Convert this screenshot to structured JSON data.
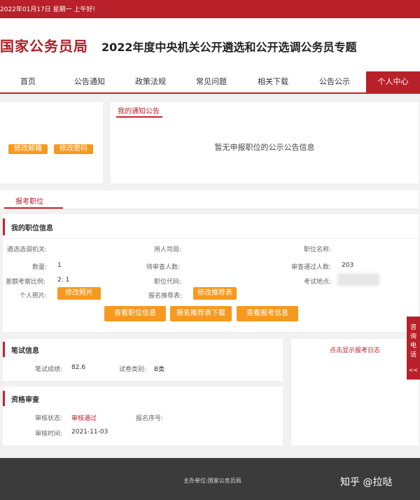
{
  "topbar": {
    "date": "2022年01月17日 星期一 上午好!"
  },
  "header": {
    "logo": "国家公务员局",
    "title": "2022年度中央机关公开遴选和公开选调公务员专题"
  },
  "nav": [
    "首页",
    "公告通知",
    "政策法规",
    "常见问题",
    "相关下载",
    "公告公示",
    "个人中心"
  ],
  "account": {
    "edit_email": "修改邮箱",
    "edit_password": "修改密码"
  },
  "notices": {
    "title": "我的通知公告",
    "empty": "暂无申报职位的公示公告信息"
  },
  "position_tab": "报考职位",
  "position": {
    "title": "我的职位信息",
    "agency_label": "遴选选调机关:",
    "department_label": "用人司局:",
    "name_label": "职位名称:",
    "count_label": "数量:",
    "count_value": "1",
    "pending_label": "待审查人数:",
    "passed_label": "审查通过人数:",
    "passed_value": "203",
    "ratio_label": "差额考察比例:",
    "ratio_value": "2: 1",
    "code_label": "职位代码:",
    "location_label": "考试地点:",
    "photo_label": "个人照片:",
    "photo_button": "修改照片",
    "form_label": "报名推荐表:",
    "form_button": "修改推荐表",
    "view_position": "查看职位信息",
    "download_form": "报名推荐表下载",
    "view_registration": "查看报考信息"
  },
  "written": {
    "title": "笔试信息",
    "score_label": "笔试成绩:",
    "score_value": "82.6",
    "type_label": "试卷类别:",
    "type_value": "B类"
  },
  "log_link": "点击显示报考日志",
  "review": {
    "title": "资格审查",
    "status_label": "审核状态:",
    "status_value": "审核通过",
    "serial_label": "报名序号:",
    "time_label": "审核时间:",
    "time_value": "2021-11-03"
  },
  "side_tab": {
    "label": "咨询电话",
    "arrow": "<<"
  },
  "footer": {
    "sponsor": "主办单位:国家公务员局",
    "watermark": "知乎 @拉哒"
  },
  "colors": {
    "brand_red": "#b8202a",
    "button_orange": "#f59a1f"
  }
}
